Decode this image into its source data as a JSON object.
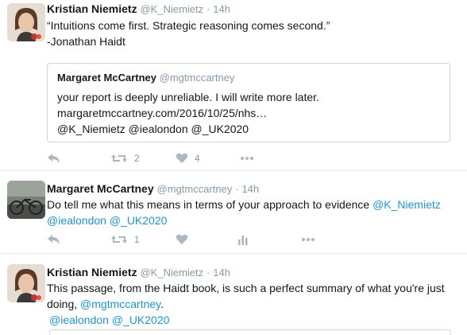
{
  "tweets": [
    {
      "name": "Kristian Niemietz",
      "handle": "@K_Niemietz",
      "time": "14h",
      "lines": [
        "“Intuitions come first. Strategic reasoning comes second.”",
        "-Jonathan Haidt"
      ],
      "quote": {
        "name": "Margaret McCartney",
        "handle": "@mgtmccartney",
        "lines": [
          "your report is deeply unreliable. I will write more later.",
          "margaretmccartney.com/2016/10/25/nhs…",
          "@K_Niemietz @iealondon @_UK2020"
        ]
      },
      "retweets": "2",
      "likes": "4"
    },
    {
      "name": "Margaret McCartney",
      "handle": "@mgtmccartney",
      "time": "14h",
      "line1_text": "Do tell me what this means in terms of your approach to evidence ",
      "line1_link": "@K_Niemietz",
      "line2": "@iealondon @_UK2020",
      "retweets": "1"
    },
    {
      "name": "Kristian Niemietz",
      "handle": "@K_Niemietz",
      "time": "14h",
      "line1": "This passage, from the Haidt book, is such a perfect summary of what you're just",
      "line2_text": "doing, ",
      "line2_link": "@mgtmccartney",
      "line2_end": ".",
      "line3": "@iealondon @_UK2020"
    }
  ],
  "colors": {
    "link": "#1b95e0",
    "muted": "#8899a6",
    "icon": "#aab8c2"
  }
}
